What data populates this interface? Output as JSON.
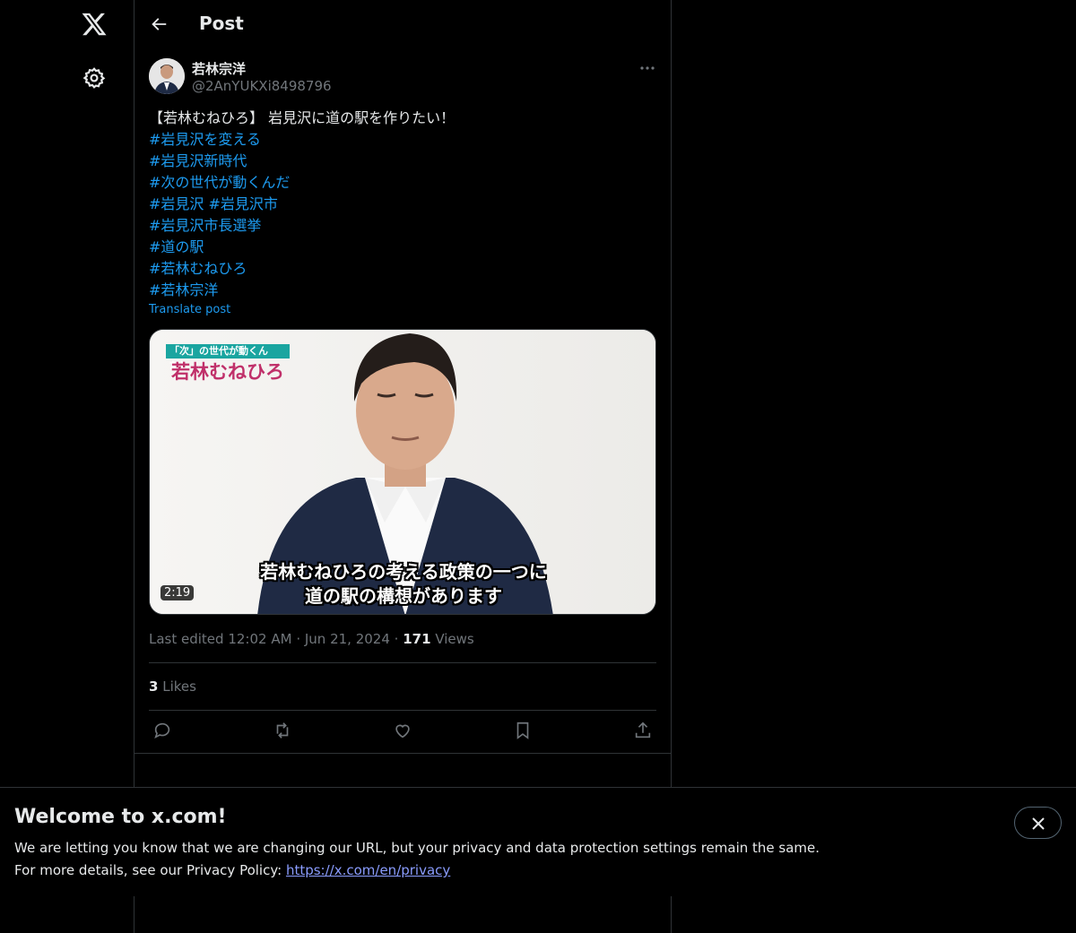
{
  "header": {
    "title": "Post"
  },
  "post": {
    "author_name": "若林宗洋",
    "author_handle": "@2AnYUKXi8498796",
    "text_lines": [
      "【若林むねひろ】 岩見沢に道の駅を作りたい！",
      "#岩見沢を変える",
      "#岩見沢新時代",
      "#次の世代が動くんだ",
      "#岩見沢 #岩見沢市",
      "#岩見沢市長選挙",
      "#道の駅",
      "#若林むねひろ",
      "#若林宗洋"
    ],
    "translate_label": "Translate post",
    "media": {
      "duration": "2:19",
      "badge_top": "「次」の世代が動くんだ！",
      "badge_main": "若林むねひろ",
      "caption_line1": "若林むねひろの考える政策の一つに",
      "caption_line2": "道の駅の構想があります"
    },
    "meta": {
      "edited_label": "Last edited 12:02 AM",
      "separator": "·",
      "date": "Jun 21, 2024",
      "views_count": "171",
      "views_label": "Views"
    },
    "likes": {
      "count": "3",
      "label": "Likes"
    },
    "actions": [
      "reply-icon",
      "repost-icon",
      "like-icon",
      "bookmark-icon",
      "share-icon"
    ]
  },
  "banner": {
    "title": "Welcome to x.com!",
    "line1": "We are letting you know that we are changing our URL, but your privacy and data protection settings remain the same.",
    "line2_prefix": "For more details, see our Privacy Policy: ",
    "link": "https://x.com/en/privacy"
  },
  "colors": {
    "accent": "#1d9bf0",
    "background": "#000000",
    "muted": "#71767b",
    "link": "#8a9cfe"
  }
}
